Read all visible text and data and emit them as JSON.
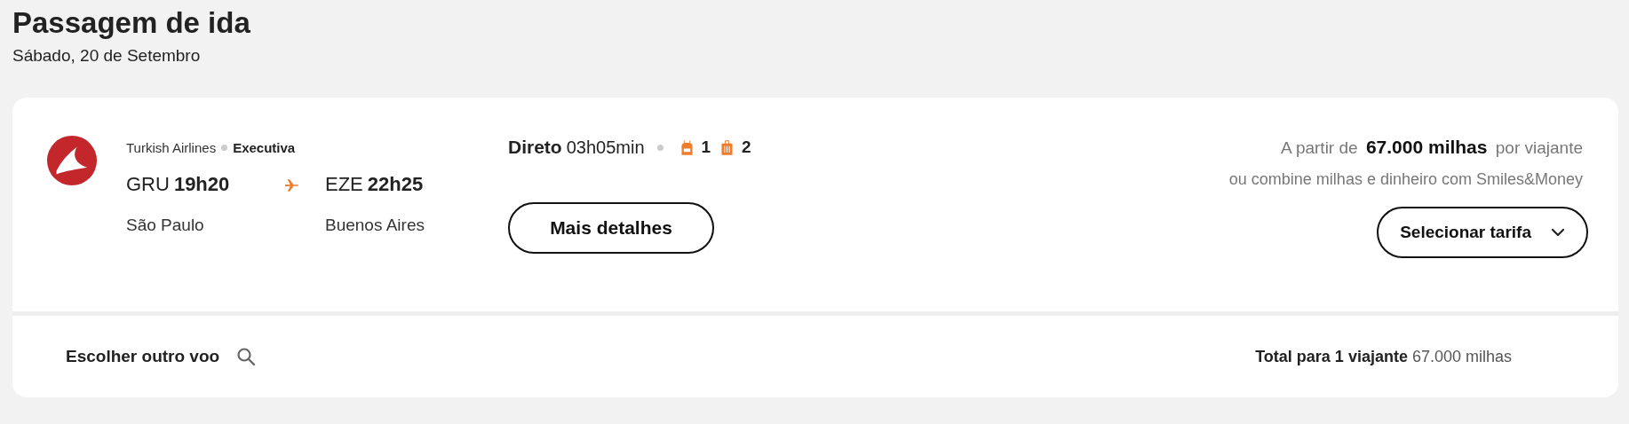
{
  "header": {
    "title": "Passagem de ida",
    "date": "Sábado, 20 de Setembro"
  },
  "flight": {
    "airline": "Turkish Airlines",
    "cabin": "Executiva",
    "origin": {
      "code": "GRU",
      "time": "19h20",
      "city": "São Paulo"
    },
    "destination": {
      "code": "EZE",
      "time": "22h25",
      "city": "Buenos Aires"
    },
    "stop_type": "Direto",
    "duration": "03h05min",
    "baggage": [
      {
        "kind": "backpack",
        "count": "1"
      },
      {
        "kind": "suitcase",
        "count": "2"
      }
    ],
    "details_button": "Mais detalhes",
    "price": "A partir de **67.000 milhas** por viajante",
    "price_note": "ou combine milhas e dinheiro com Smiles&Money",
    "select_button": "Selecionar tarifa"
  },
  "footer": {
    "other_flight": "Escolher outro voo",
    "total": "**Total para 1 viajante** 67.000 milhas"
  }
}
